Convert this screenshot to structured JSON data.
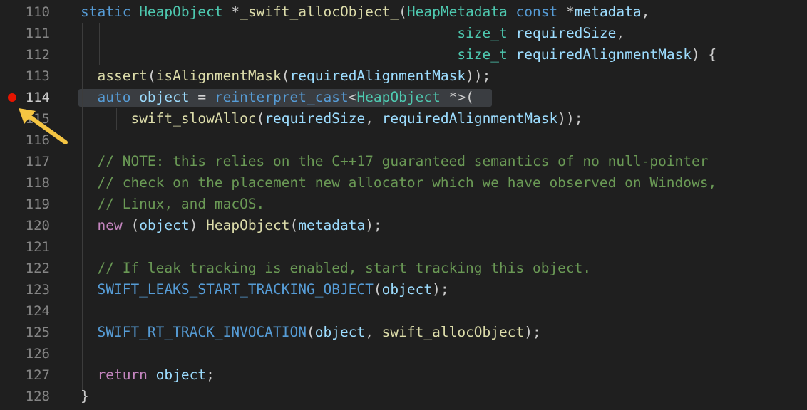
{
  "editor": {
    "breakpoint_line": "114",
    "lines": [
      {
        "n": "110",
        "tokens": [
          [
            "kw",
            "static "
          ],
          [
            "ty",
            "HeapObject "
          ],
          [
            "op",
            "*"
          ],
          [
            "fn",
            "_swift_allocObject_"
          ],
          [
            "pu",
            "("
          ],
          [
            "ty",
            "HeapMetadata "
          ],
          [
            "kw",
            "const "
          ],
          [
            "op",
            "*"
          ],
          [
            "va",
            "metadata"
          ],
          [
            "pu",
            ","
          ]
        ]
      },
      {
        "n": "111",
        "tokens": [
          [
            "pu",
            "                                             "
          ],
          [
            "ty",
            "size_t "
          ],
          [
            "va",
            "requiredSize"
          ],
          [
            "pu",
            ","
          ]
        ]
      },
      {
        "n": "112",
        "tokens": [
          [
            "pu",
            "                                             "
          ],
          [
            "ty",
            "size_t "
          ],
          [
            "va",
            "requiredAlignmentMask"
          ],
          [
            "pu",
            ") {"
          ]
        ]
      },
      {
        "n": "113",
        "tokens": [
          [
            "pu",
            "  "
          ],
          [
            "fn",
            "assert"
          ],
          [
            "pu",
            "("
          ],
          [
            "fn",
            "isAlignmentMask"
          ],
          [
            "pu",
            "("
          ],
          [
            "va",
            "requiredAlignmentMask"
          ],
          [
            "pu",
            "));"
          ]
        ]
      },
      {
        "n": "114",
        "tokens": [
          [
            "pu",
            "  "
          ],
          [
            "kw",
            "auto "
          ],
          [
            "va",
            "object "
          ],
          [
            "op",
            "= "
          ],
          [
            "kw",
            "reinterpret_cast"
          ],
          [
            "pu",
            "<"
          ],
          [
            "ty",
            "HeapObject "
          ],
          [
            "op",
            "*"
          ],
          [
            "pu",
            ">("
          ]
        ]
      },
      {
        "n": "115",
        "tokens": [
          [
            "pu",
            "      "
          ],
          [
            "fn",
            "swift_slowAlloc"
          ],
          [
            "pu",
            "("
          ],
          [
            "va",
            "requiredSize"
          ],
          [
            "pu",
            ", "
          ],
          [
            "va",
            "requiredAlignmentMask"
          ],
          [
            "pu",
            "));"
          ]
        ]
      },
      {
        "n": "116",
        "tokens": []
      },
      {
        "n": "117",
        "tokens": [
          [
            "pu",
            "  "
          ],
          [
            "cm",
            "// NOTE: this relies on the C++17 guaranteed semantics of no null-pointer"
          ]
        ]
      },
      {
        "n": "118",
        "tokens": [
          [
            "pu",
            "  "
          ],
          [
            "cm",
            "// check on the placement new allocator which we have observed on Windows,"
          ]
        ]
      },
      {
        "n": "119",
        "tokens": [
          [
            "pu",
            "  "
          ],
          [
            "cm",
            "// Linux, and macOS."
          ]
        ]
      },
      {
        "n": "120",
        "tokens": [
          [
            "pu",
            "  "
          ],
          [
            "kw2",
            "new "
          ],
          [
            "pu",
            "("
          ],
          [
            "va",
            "object"
          ],
          [
            "pu",
            ") "
          ],
          [
            "fn",
            "HeapObject"
          ],
          [
            "pu",
            "("
          ],
          [
            "va",
            "metadata"
          ],
          [
            "pu",
            ");"
          ]
        ]
      },
      {
        "n": "121",
        "tokens": []
      },
      {
        "n": "122",
        "tokens": [
          [
            "pu",
            "  "
          ],
          [
            "cm",
            "// If leak tracking is enabled, start tracking this object."
          ]
        ]
      },
      {
        "n": "123",
        "tokens": [
          [
            "pu",
            "  "
          ],
          [
            "mac",
            "SWIFT_LEAKS_START_TRACKING_OBJECT"
          ],
          [
            "pu",
            "("
          ],
          [
            "va",
            "object"
          ],
          [
            "pu",
            ");"
          ]
        ]
      },
      {
        "n": "124",
        "tokens": []
      },
      {
        "n": "125",
        "tokens": [
          [
            "pu",
            "  "
          ],
          [
            "mac",
            "SWIFT_RT_TRACK_INVOCATION"
          ],
          [
            "pu",
            "("
          ],
          [
            "va",
            "object"
          ],
          [
            "pu",
            ", "
          ],
          [
            "fn",
            "swift_allocObject"
          ],
          [
            "pu",
            ");"
          ]
        ]
      },
      {
        "n": "126",
        "tokens": []
      },
      {
        "n": "127",
        "tokens": [
          [
            "pu",
            "  "
          ],
          [
            "kw2",
            "return "
          ],
          [
            "va",
            "object"
          ],
          [
            "pu",
            ";"
          ]
        ]
      },
      {
        "n": "128",
        "tokens": [
          [
            "pu",
            "}"
          ]
        ]
      }
    ]
  },
  "icons": {
    "breakpoint": "breakpoint-icon",
    "arrow": "arrow-pointer-icon"
  },
  "colors": {
    "background": "#1f1f1f",
    "breakpoint": "#e51400",
    "arrow": "#f5c542",
    "highlight": "#3a3d41"
  }
}
